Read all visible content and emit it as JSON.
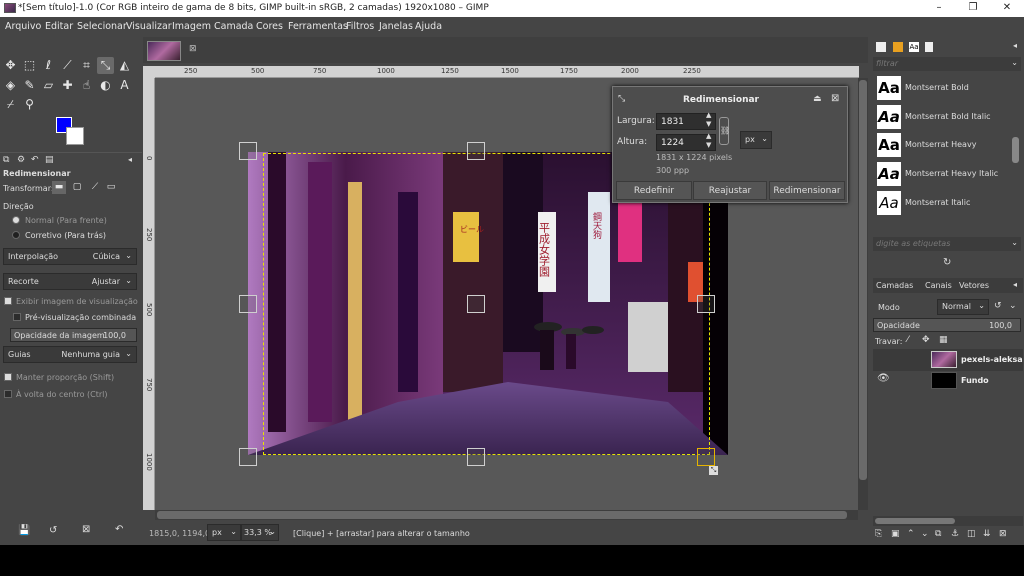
{
  "window": {
    "title": "*[Sem título]-1.0 (Cor RGB inteiro de gama de 8 bits, GIMP built-in sRGB, 2 camadas) 1920x1080 – GIMP",
    "minimize": "–",
    "maximize": "❐",
    "close": "✕"
  },
  "menu": [
    "Arquivo",
    "Editar",
    "Selecionar",
    "Visualizar",
    "Imagem",
    "Camada",
    "Cores",
    "Ferramentas",
    "Filtros",
    "Janelas",
    "Ajuda"
  ],
  "tool_options": {
    "title": "Redimensionar",
    "transform_label": "Transformar:",
    "direction_label": "Direção",
    "direction_normal": "Normal (Para frente)",
    "direction_corrective": "Corretivo (Para trás)",
    "interpolation_label": "Interpolação",
    "interpolation_value": "Cúbica",
    "clipping_label": "Recorte",
    "clipping_value": "Ajustar",
    "show_preview": "Exibir imagem de visualização",
    "composited_preview": "Pré-visualização combinada",
    "image_opacity_label": "Opacidade da imagem",
    "image_opacity_value": "100,0",
    "guides_label": "Guias",
    "guides_value": "Nenhuma guia",
    "keep_aspect": "Manter proporção (Shift)",
    "around_center": "À volta do centro (Ctrl)"
  },
  "colors": {
    "foreground": "#0000ff",
    "background": "#ffffff",
    "selection_outline": "#e6e600"
  },
  "rulers": {
    "horizontal": [
      "250",
      "500",
      "750",
      "1000",
      "1250",
      "1500",
      "1750",
      "2000",
      "2250"
    ],
    "vertical": [
      "0",
      "250",
      "500",
      "750",
      "1000"
    ]
  },
  "dialog": {
    "title": "Redimensionar",
    "width_label": "Largura:",
    "width_value": "1831",
    "height_label": "Altura:",
    "height_value": "1224",
    "unit": "px",
    "info_size": "1831 x 1224 pixels",
    "info_res": "300 ppp",
    "reset": "Redefinir",
    "readjust": "Reajustar",
    "scale": "Redimensionar"
  },
  "status": {
    "coords": "1815,0, 1194,0",
    "unit": "px",
    "zoom": "33,3 %",
    "message": "[Clique] + [arrastar] para alterar o tamanho"
  },
  "fonts_panel": {
    "filter_placeholder": "filtrar",
    "tags_placeholder": "digite as etiquetas",
    "items": [
      "Montserrat Bold",
      "Montserrat Bold Italic",
      "Montserrat Heavy",
      "Montserrat Heavy Italic",
      "Montserrat Italic"
    ],
    "sample": "Aa"
  },
  "layers_panel": {
    "tabs": [
      "Camadas",
      "Canais",
      "Vetores"
    ],
    "mode_label": "Modo",
    "mode_value": "Normal",
    "opacity_label": "Opacidade",
    "opacity_value": "100,0",
    "lock_label": "Travar:",
    "layers": [
      "pexels-aleksa",
      "Fundo"
    ]
  },
  "image_signs": {
    "sign1": "平成女学園",
    "sign2": "ビール",
    "sign3": "鋼天狗"
  }
}
